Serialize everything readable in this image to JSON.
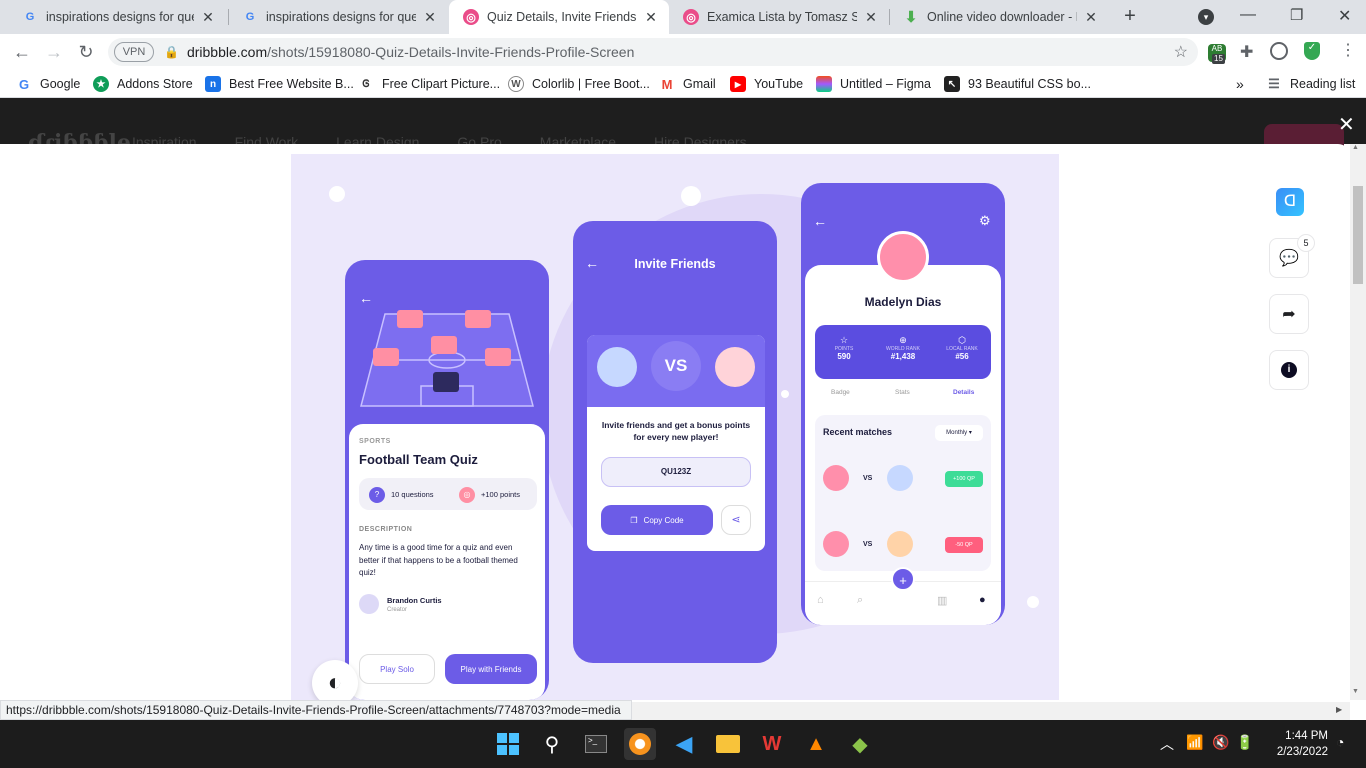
{
  "browser": {
    "tabs": [
      {
        "title": "inspirations designs for quest",
        "favicon": "google-icon"
      },
      {
        "title": "inspirations designs for quest",
        "favicon": "google-icon"
      },
      {
        "title": "Quiz Details, Invite Friends &",
        "favicon": "dribbble-icon"
      },
      {
        "title": "Examica Lista by Tomasz Szta",
        "favicon": "dribbble-icon"
      },
      {
        "title": "Online video downloader - D",
        "favicon": "download-icon"
      }
    ],
    "vpn_label": "VPN",
    "url_domain": "dribbble.com",
    "url_path": "/shots/15918080-Quiz-Details-Invite-Friends-Profile-Screen",
    "extension_badge": "15",
    "bookmarks": [
      "Google",
      "Addons Store",
      "Best Free Website B...",
      "Free Clipart Picture...",
      "Colorlib | Free Boot...",
      "Gmail",
      "YouTube",
      "Untitled – Figma",
      "93 Beautiful CSS bo..."
    ],
    "reading_list": "Reading list",
    "overflow": "»"
  },
  "dribbble_header": [
    "Inspiration",
    "Find Work",
    "Learn Design",
    "Go Pro",
    "Marketplace",
    "Hire Designers"
  ],
  "side_actions": {
    "comments_count": "5"
  },
  "shot": {
    "quiz": {
      "category": "SPORTS",
      "title": "Football Team Quiz",
      "questions": "10 questions",
      "points": "+100 points",
      "description_label": "DESCRIPTION",
      "description": "Any time is a good time for a quiz and even better if that happens to be a football themed quiz!",
      "creator_name": "Brandon Curtis",
      "creator_role": "Creator",
      "play_solo": "Play Solo",
      "play_friends": "Play with Friends"
    },
    "invite": {
      "title": "Invite Friends",
      "vs": "VS",
      "message": "Invite friends and get a bonus points for every new player!",
      "code": "QU123Z",
      "copy_label": "Copy Code"
    },
    "profile": {
      "name": "Madelyn Dias",
      "stats": [
        {
          "label": "POINTS",
          "value": "590"
        },
        {
          "label": "WORLD RANK",
          "value": "#1,438"
        },
        {
          "label": "LOCAL RANK",
          "value": "#56"
        }
      ],
      "tabs": [
        "Badge",
        "Stats",
        "Details"
      ],
      "recent_label": "Recent matches",
      "filter": "Monthly",
      "matches": [
        {
          "vs": "VS",
          "result": "+100 QP",
          "color": "#3ddc97"
        },
        {
          "vs": "VS",
          "result": "-50 QP",
          "color": "#ff5f7e"
        }
      ],
      "fab": "+"
    }
  },
  "status_url": "https://dribbble.com/shots/15918080-Quiz-Details-Invite-Friends-Profile-Screen/attachments/7748703?mode=media",
  "clock": {
    "time": "1:44 PM",
    "date": "2/23/2022"
  },
  "colors": {
    "accent": "#6c5ce7",
    "page_bg": "#ece8fb"
  }
}
